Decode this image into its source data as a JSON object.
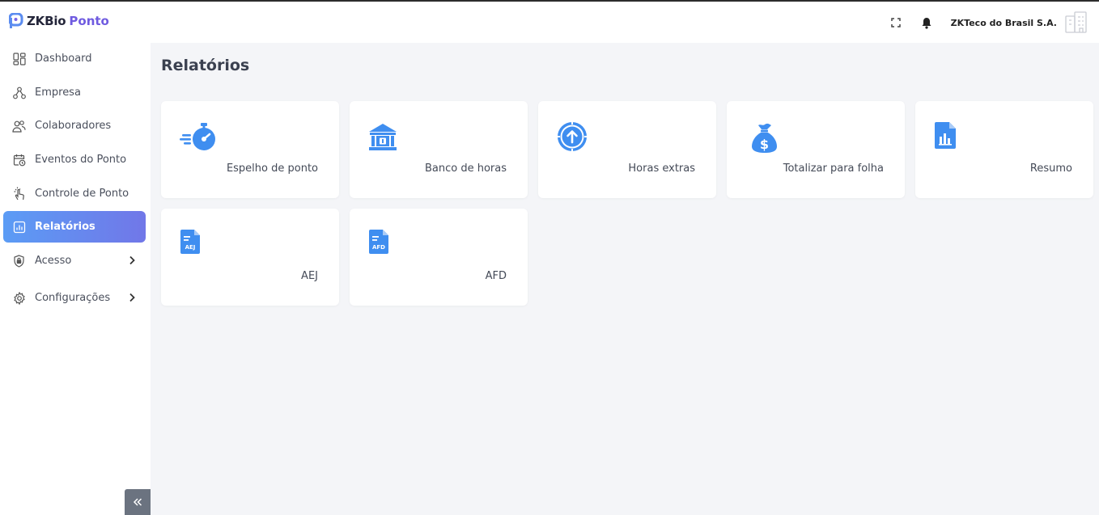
{
  "app": {
    "brand_part1": "ZKBio",
    "brand_part2": "Ponto",
    "company": "ZKTeco do Brasil S.A.",
    "accent": "#5b9cf5",
    "brand_color": "#6f5be0"
  },
  "sidebar": {
    "items": [
      {
        "label": "Dashboard",
        "icon": "dashboard-icon"
      },
      {
        "label": "Empresa",
        "icon": "org-icon"
      },
      {
        "label": "Colaboradores",
        "icon": "users-icon"
      },
      {
        "label": "Eventos do Ponto",
        "icon": "calendar-clock-icon"
      },
      {
        "label": "Controle de Ponto",
        "icon": "hand-pointer-icon"
      },
      {
        "label": "Relatórios",
        "icon": "report-icon",
        "active": true
      },
      {
        "label": "Acesso",
        "icon": "shield-icon",
        "has_children": true
      },
      {
        "label": "Configurações",
        "icon": "gear-icon",
        "has_children": true
      }
    ]
  },
  "main": {
    "title": "Relatórios",
    "cards": [
      {
        "label": "Espelho de ponto",
        "icon": "stopwatch-icon"
      },
      {
        "label": "Banco de horas",
        "icon": "bank-icon"
      },
      {
        "label": "Horas extras",
        "icon": "clock-up-icon"
      },
      {
        "label": "Totalizar para folha",
        "icon": "money-bag-icon"
      },
      {
        "label": "Resumo",
        "icon": "chart-document-icon"
      },
      {
        "label": "AEJ",
        "icon": "aej-document-icon",
        "badge": "AEJ"
      },
      {
        "label": "AFD",
        "icon": "afd-document-icon",
        "badge": "AFD"
      }
    ]
  }
}
